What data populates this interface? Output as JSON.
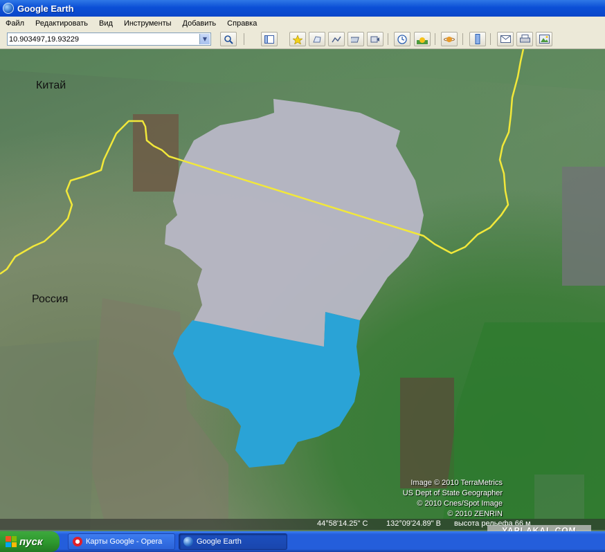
{
  "window": {
    "title": "Google Earth",
    "icon": "google-earth-globe-icon"
  },
  "menu": [
    "Файл",
    "Редактировать",
    "Вид",
    "Инструменты",
    "Добавить",
    "Справка"
  ],
  "search": {
    "value": "10.903497,19.93229"
  },
  "toolbar": {
    "icons": [
      "search-icon",
      "sidebar-icon",
      "placemark-icon",
      "polygon-icon",
      "path-icon",
      "overlay-icon",
      "tour-icon",
      "historical-imagery-icon",
      "sun-icon",
      "planets-icon",
      "ruler-icon",
      "email-icon",
      "print-icon",
      "save-image-icon"
    ]
  },
  "map": {
    "labels": {
      "china": "Китай",
      "russia": "Россия"
    },
    "credits": [
      "Image © 2010 TerraMetrics",
      "US Dept of State Geographer",
      "© 2010 Cnes/Spot Image",
      "© 2010 ZENRIN"
    ],
    "status": {
      "lat": "44°58'14.25\" С",
      "lon": "132°09'24.89\" В",
      "elevation": "высота рельефа   66 м"
    },
    "watermark": "YAPLAKAL.COM",
    "colors": {
      "border": "#f2e83a",
      "lake_gray": "#b9b8c6",
      "lake_blue": "#2aa3d6"
    }
  },
  "taskbar": {
    "start_label": "пуск",
    "tasks": [
      {
        "label": "Карты Google - Opera",
        "icon": "opera-icon"
      },
      {
        "label": "Google Earth",
        "icon": "google-earth-icon"
      }
    ]
  }
}
